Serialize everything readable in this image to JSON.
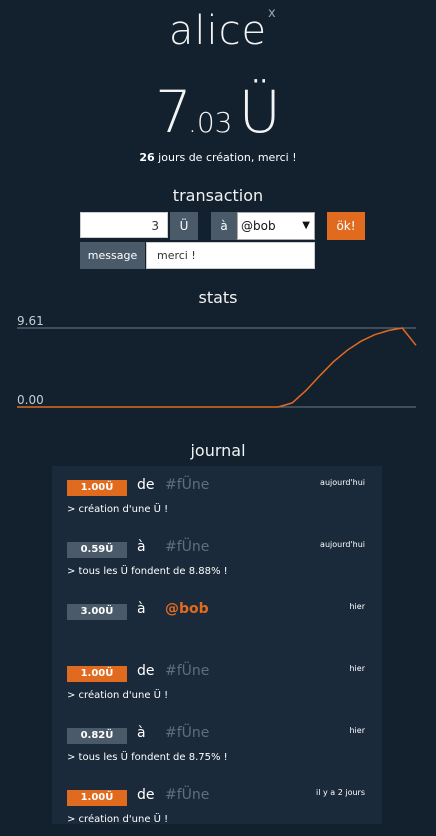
{
  "header": {
    "username": "alice",
    "close": "x"
  },
  "balance": {
    "int": "7",
    "dec": ".03",
    "unit": "Ü"
  },
  "creation": {
    "days": "26",
    "text": " jours de création, merci !"
  },
  "transaction": {
    "title": "transaction",
    "amount": "3",
    "unit": "Ü",
    "to_label": "à",
    "recipient": "@bob",
    "ok": "ök!",
    "message_label": "message",
    "message_value": "merci !"
  },
  "stats": {
    "title": "stats",
    "y_max": "9.61",
    "y_min": "0.00"
  },
  "chart_data": {
    "type": "line",
    "title": "stats",
    "ylim": [
      0,
      9.61
    ],
    "series": [
      {
        "values": [
          0,
          0,
          0,
          0,
          0,
          0,
          0,
          0,
          0,
          0,
          0,
          0,
          0,
          0,
          0,
          0,
          0,
          0,
          0,
          0,
          0.5,
          2.0,
          3.8,
          5.5,
          6.9,
          8.0,
          8.8,
          9.3,
          9.61,
          7.5
        ]
      }
    ],
    "line_color": "#e06b1f",
    "grid_color": "#6b7784"
  },
  "journal": {
    "title": "journal",
    "entries": [
      {
        "amount": "1.00Ü",
        "dir": "de",
        "party": "#fÜne",
        "when": "aujourd'hui",
        "note": "> création d'une Ü !",
        "kind": "orange"
      },
      {
        "amount": "0.59Ü",
        "dir": "à",
        "party": "#fÜne",
        "when": "aujourd'hui",
        "note": "> tous les Ü fondent de 8.88% !",
        "kind": "gray"
      },
      {
        "amount": "3.00Ü",
        "dir": "à",
        "party": "@bob",
        "when": "hier",
        "note": "",
        "kind": "gray"
      },
      {
        "amount": "1.00Ü",
        "dir": "de",
        "party": "#fÜne",
        "when": "hier",
        "note": "> création d'une Ü !",
        "kind": "orange"
      },
      {
        "amount": "0.82Ü",
        "dir": "à",
        "party": "#fÜne",
        "when": "hier",
        "note": "> tous les Ü fondent de 8.75% !",
        "kind": "gray"
      },
      {
        "amount": "1.00Ü",
        "dir": "de",
        "party": "#fÜne",
        "when": "il y a 2 jours",
        "note": "> création d'une Ü !",
        "kind": "orange"
      }
    ]
  }
}
